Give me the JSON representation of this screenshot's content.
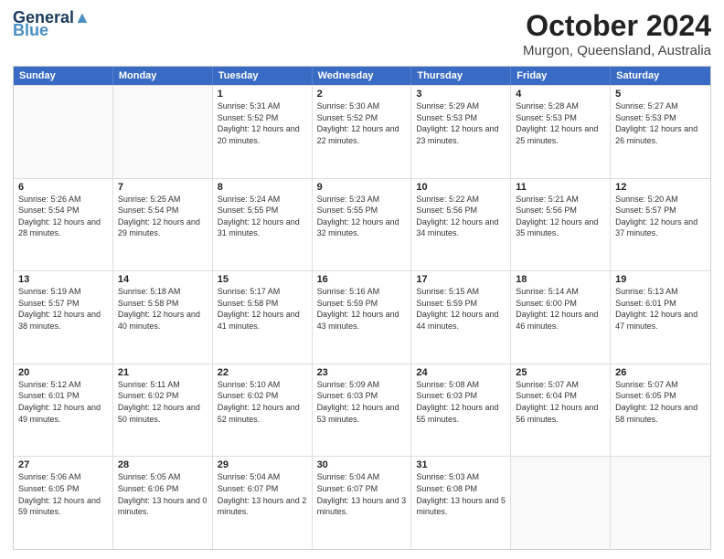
{
  "logo": {
    "line1": "General",
    "line2": "Blue"
  },
  "title": "October 2024",
  "subtitle": "Murgon, Queensland, Australia",
  "headers": [
    "Sunday",
    "Monday",
    "Tuesday",
    "Wednesday",
    "Thursday",
    "Friday",
    "Saturday"
  ],
  "rows": [
    [
      {
        "day": "",
        "info": ""
      },
      {
        "day": "",
        "info": ""
      },
      {
        "day": "1",
        "info": "Sunrise: 5:31 AM\nSunset: 5:52 PM\nDaylight: 12 hours and 20 minutes."
      },
      {
        "day": "2",
        "info": "Sunrise: 5:30 AM\nSunset: 5:52 PM\nDaylight: 12 hours and 22 minutes."
      },
      {
        "day": "3",
        "info": "Sunrise: 5:29 AM\nSunset: 5:53 PM\nDaylight: 12 hours and 23 minutes."
      },
      {
        "day": "4",
        "info": "Sunrise: 5:28 AM\nSunset: 5:53 PM\nDaylight: 12 hours and 25 minutes."
      },
      {
        "day": "5",
        "info": "Sunrise: 5:27 AM\nSunset: 5:53 PM\nDaylight: 12 hours and 26 minutes."
      }
    ],
    [
      {
        "day": "6",
        "info": "Sunrise: 5:26 AM\nSunset: 5:54 PM\nDaylight: 12 hours and 28 minutes."
      },
      {
        "day": "7",
        "info": "Sunrise: 5:25 AM\nSunset: 5:54 PM\nDaylight: 12 hours and 29 minutes."
      },
      {
        "day": "8",
        "info": "Sunrise: 5:24 AM\nSunset: 5:55 PM\nDaylight: 12 hours and 31 minutes."
      },
      {
        "day": "9",
        "info": "Sunrise: 5:23 AM\nSunset: 5:55 PM\nDaylight: 12 hours and 32 minutes."
      },
      {
        "day": "10",
        "info": "Sunrise: 5:22 AM\nSunset: 5:56 PM\nDaylight: 12 hours and 34 minutes."
      },
      {
        "day": "11",
        "info": "Sunrise: 5:21 AM\nSunset: 5:56 PM\nDaylight: 12 hours and 35 minutes."
      },
      {
        "day": "12",
        "info": "Sunrise: 5:20 AM\nSunset: 5:57 PM\nDaylight: 12 hours and 37 minutes."
      }
    ],
    [
      {
        "day": "13",
        "info": "Sunrise: 5:19 AM\nSunset: 5:57 PM\nDaylight: 12 hours and 38 minutes."
      },
      {
        "day": "14",
        "info": "Sunrise: 5:18 AM\nSunset: 5:58 PM\nDaylight: 12 hours and 40 minutes."
      },
      {
        "day": "15",
        "info": "Sunrise: 5:17 AM\nSunset: 5:58 PM\nDaylight: 12 hours and 41 minutes."
      },
      {
        "day": "16",
        "info": "Sunrise: 5:16 AM\nSunset: 5:59 PM\nDaylight: 12 hours and 43 minutes."
      },
      {
        "day": "17",
        "info": "Sunrise: 5:15 AM\nSunset: 5:59 PM\nDaylight: 12 hours and 44 minutes."
      },
      {
        "day": "18",
        "info": "Sunrise: 5:14 AM\nSunset: 6:00 PM\nDaylight: 12 hours and 46 minutes."
      },
      {
        "day": "19",
        "info": "Sunrise: 5:13 AM\nSunset: 6:01 PM\nDaylight: 12 hours and 47 minutes."
      }
    ],
    [
      {
        "day": "20",
        "info": "Sunrise: 5:12 AM\nSunset: 6:01 PM\nDaylight: 12 hours and 49 minutes."
      },
      {
        "day": "21",
        "info": "Sunrise: 5:11 AM\nSunset: 6:02 PM\nDaylight: 12 hours and 50 minutes."
      },
      {
        "day": "22",
        "info": "Sunrise: 5:10 AM\nSunset: 6:02 PM\nDaylight: 12 hours and 52 minutes."
      },
      {
        "day": "23",
        "info": "Sunrise: 5:09 AM\nSunset: 6:03 PM\nDaylight: 12 hours and 53 minutes."
      },
      {
        "day": "24",
        "info": "Sunrise: 5:08 AM\nSunset: 6:03 PM\nDaylight: 12 hours and 55 minutes."
      },
      {
        "day": "25",
        "info": "Sunrise: 5:07 AM\nSunset: 6:04 PM\nDaylight: 12 hours and 56 minutes."
      },
      {
        "day": "26",
        "info": "Sunrise: 5:07 AM\nSunset: 6:05 PM\nDaylight: 12 hours and 58 minutes."
      }
    ],
    [
      {
        "day": "27",
        "info": "Sunrise: 5:06 AM\nSunset: 6:05 PM\nDaylight: 12 hours and 59 minutes."
      },
      {
        "day": "28",
        "info": "Sunrise: 5:05 AM\nSunset: 6:06 PM\nDaylight: 13 hours and 0 minutes."
      },
      {
        "day": "29",
        "info": "Sunrise: 5:04 AM\nSunset: 6:07 PM\nDaylight: 13 hours and 2 minutes."
      },
      {
        "day": "30",
        "info": "Sunrise: 5:04 AM\nSunset: 6:07 PM\nDaylight: 13 hours and 3 minutes."
      },
      {
        "day": "31",
        "info": "Sunrise: 5:03 AM\nSunset: 6:08 PM\nDaylight: 13 hours and 5 minutes."
      },
      {
        "day": "",
        "info": ""
      },
      {
        "day": "",
        "info": ""
      }
    ]
  ]
}
